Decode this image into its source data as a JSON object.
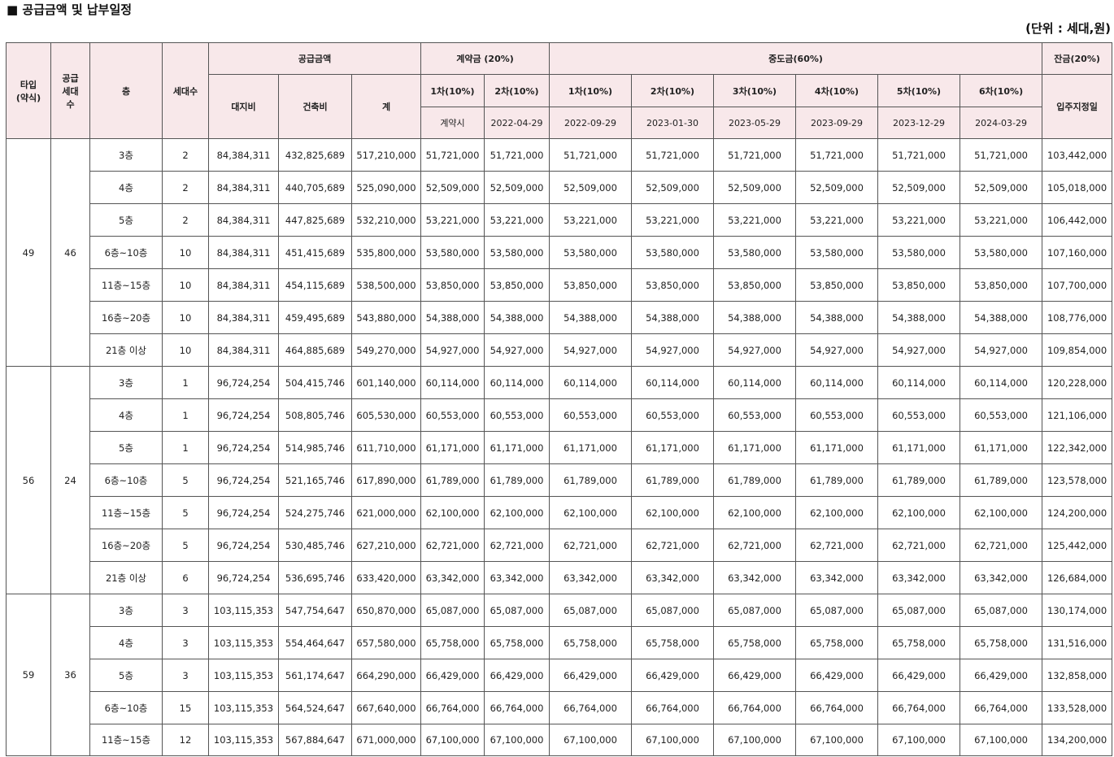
{
  "title": "■ 공급금액 및 납부일정",
  "unit": "(단위 : 세대,원)",
  "headers": {
    "type": "타입\n(약식)",
    "supply_units": "공급\n세대\n수",
    "floor": "층",
    "households": "세대수",
    "supply_amount": "공급금액",
    "land": "대지비",
    "building": "건축비",
    "total": "계",
    "deposit": "계약금 (20%)",
    "deposit_1": "1차(10%)",
    "deposit_2": "2차(10%)",
    "deposit_1_date": "계약시",
    "deposit_2_date": "2022-04-29",
    "middle": "중도금(60%)",
    "middle_items": [
      {
        "label": "1차(10%)",
        "date": "2022-09-29"
      },
      {
        "label": "2차(10%)",
        "date": "2023-01-30"
      },
      {
        "label": "3차(10%)",
        "date": "2023-05-29"
      },
      {
        "label": "4차(10%)",
        "date": "2023-09-29"
      },
      {
        "label": "5차(10%)",
        "date": "2023-12-29"
      },
      {
        "label": "6차(10%)",
        "date": "2024-03-29"
      }
    ],
    "balance": "잔금(20%)",
    "balance_date": "입주지정일"
  },
  "groups": [
    {
      "type": "49",
      "supply": "46",
      "rows": [
        {
          "floor": "3층",
          "n": "2",
          "land": "84,384,311",
          "build": "432,825,689",
          "total": "517,210,000",
          "pay": "51,721,000",
          "bal": "103,442,000"
        },
        {
          "floor": "4층",
          "n": "2",
          "land": "84,384,311",
          "build": "440,705,689",
          "total": "525,090,000",
          "pay": "52,509,000",
          "bal": "105,018,000"
        },
        {
          "floor": "5층",
          "n": "2",
          "land": "84,384,311",
          "build": "447,825,689",
          "total": "532,210,000",
          "pay": "53,221,000",
          "bal": "106,442,000"
        },
        {
          "floor": "6층~10층",
          "n": "10",
          "land": "84,384,311",
          "build": "451,415,689",
          "total": "535,800,000",
          "pay": "53,580,000",
          "bal": "107,160,000"
        },
        {
          "floor": "11층~15층",
          "n": "10",
          "land": "84,384,311",
          "build": "454,115,689",
          "total": "538,500,000",
          "pay": "53,850,000",
          "bal": "107,700,000"
        },
        {
          "floor": "16층~20층",
          "n": "10",
          "land": "84,384,311",
          "build": "459,495,689",
          "total": "543,880,000",
          "pay": "54,388,000",
          "bal": "108,776,000"
        },
        {
          "floor": "21층 이상",
          "n": "10",
          "land": "84,384,311",
          "build": "464,885,689",
          "total": "549,270,000",
          "pay": "54,927,000",
          "bal": "109,854,000"
        }
      ]
    },
    {
      "type": "56",
      "supply": "24",
      "rows": [
        {
          "floor": "3층",
          "n": "1",
          "land": "96,724,254",
          "build": "504,415,746",
          "total": "601,140,000",
          "pay": "60,114,000",
          "bal": "120,228,000"
        },
        {
          "floor": "4층",
          "n": "1",
          "land": "96,724,254",
          "build": "508,805,746",
          "total": "605,530,000",
          "pay": "60,553,000",
          "bal": "121,106,000"
        },
        {
          "floor": "5층",
          "n": "1",
          "land": "96,724,254",
          "build": "514,985,746",
          "total": "611,710,000",
          "pay": "61,171,000",
          "bal": "122,342,000"
        },
        {
          "floor": "6층~10층",
          "n": "5",
          "land": "96,724,254",
          "build": "521,165,746",
          "total": "617,890,000",
          "pay": "61,789,000",
          "bal": "123,578,000"
        },
        {
          "floor": "11층~15층",
          "n": "5",
          "land": "96,724,254",
          "build": "524,275,746",
          "total": "621,000,000",
          "pay": "62,100,000",
          "bal": "124,200,000"
        },
        {
          "floor": "16층~20층",
          "n": "5",
          "land": "96,724,254",
          "build": "530,485,746",
          "total": "627,210,000",
          "pay": "62,721,000",
          "bal": "125,442,000"
        },
        {
          "floor": "21층 이상",
          "n": "6",
          "land": "96,724,254",
          "build": "536,695,746",
          "total": "633,420,000",
          "pay": "63,342,000",
          "bal": "126,684,000"
        }
      ]
    },
    {
      "type": "59",
      "supply": "36",
      "rows": [
        {
          "floor": "3층",
          "n": "3",
          "land": "103,115,353",
          "build": "547,754,647",
          "total": "650,870,000",
          "pay": "65,087,000",
          "bal": "130,174,000"
        },
        {
          "floor": "4층",
          "n": "3",
          "land": "103,115,353",
          "build": "554,464,647",
          "total": "657,580,000",
          "pay": "65,758,000",
          "bal": "131,516,000"
        },
        {
          "floor": "5층",
          "n": "3",
          "land": "103,115,353",
          "build": "561,174,647",
          "total": "664,290,000",
          "pay": "66,429,000",
          "bal": "132,858,000"
        },
        {
          "floor": "6층~10층",
          "n": "15",
          "land": "103,115,353",
          "build": "564,524,647",
          "total": "667,640,000",
          "pay": "66,764,000",
          "bal": "133,528,000"
        },
        {
          "floor": "11층~15층",
          "n": "12",
          "land": "103,115,353",
          "build": "567,884,647",
          "total": "671,000,000",
          "pay": "67,100,000",
          "bal": "134,200,000"
        }
      ]
    }
  ]
}
